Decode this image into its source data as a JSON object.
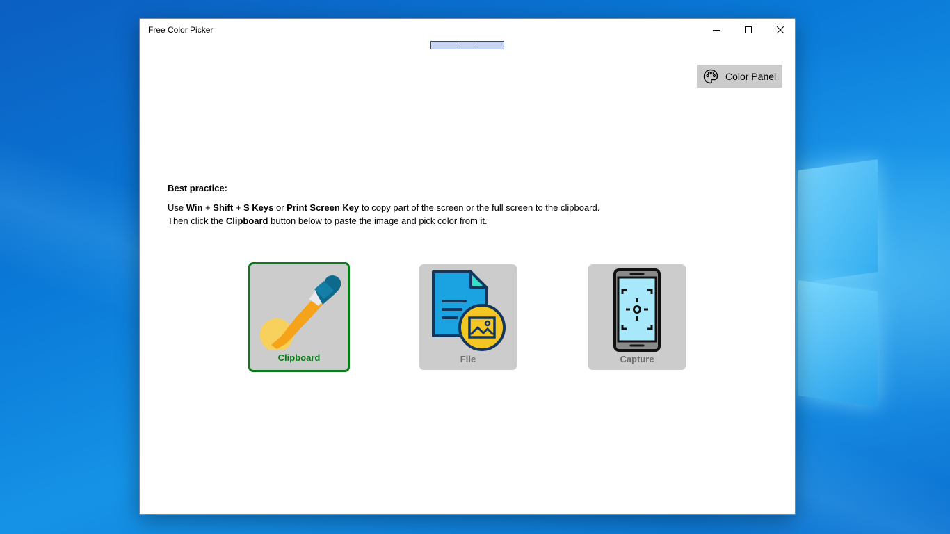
{
  "window": {
    "title": "Free Color Picker",
    "controls": {
      "minimize": "minimize-icon",
      "maximize": "maximize-icon",
      "close": "close-icon"
    }
  },
  "toolbar": {
    "color_panel_label": "Color Panel",
    "color_panel_icon": "palette-icon"
  },
  "best_practice": {
    "title": "Best practice:",
    "line1": {
      "t1": "Use ",
      "b1": "Win",
      "t2": " + ",
      "b2": "Shift",
      "t3": " + ",
      "b3": "S Keys",
      "t4": " or ",
      "b4": "Print Screen Key",
      "t5": " to copy part of the screen or the full screen to the clipboard."
    },
    "line2": {
      "t1": "Then click the ",
      "b1": "Clipboard",
      "t2": " button below to paste the image and pick color from it."
    }
  },
  "sources": [
    {
      "label": "Clipboard",
      "icon": "eyedropper-icon",
      "selected": true
    },
    {
      "label": "File",
      "icon": "image-file-icon",
      "selected": false
    },
    {
      "label": "Capture",
      "icon": "phone-camera-icon",
      "selected": false
    }
  ],
  "colors": {
    "selected_border": "#0b7a1a",
    "tile_bg": "#cccccc",
    "desktop_blue": "#0a78d7"
  }
}
